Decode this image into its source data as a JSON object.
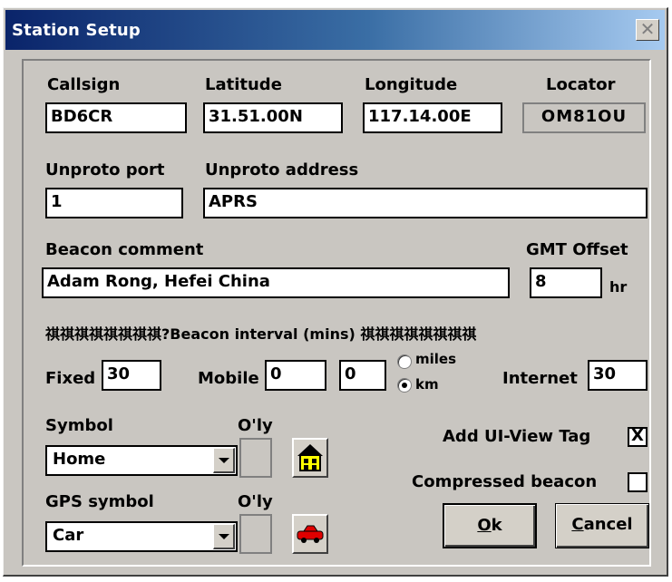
{
  "window": {
    "title": "Station Setup",
    "close_glyph": "✕"
  },
  "station": {
    "callsign_label": "Callsign",
    "callsign_value": "BD6CR",
    "latitude_label": "Latitude",
    "latitude_value": "31.51.00N",
    "longitude_label": "Longitude",
    "longitude_value": "117.14.00E",
    "locator_label": "Locator",
    "locator_value": "OM81OU"
  },
  "unproto": {
    "port_label": "Unproto port",
    "port_value": "1",
    "address_label": "Unproto address",
    "address_value": "APRS"
  },
  "beacon": {
    "comment_label": "Beacon comment",
    "comment_value": "Adam Rong, Hefei China",
    "gmt_label": "GMT Offset",
    "gmt_value": "8",
    "gmt_unit": "hr"
  },
  "interval": {
    "header_text": "祺祺祺祺祺祺祺祺?Beacon interval (mins) 祺祺祺祺祺祺祺祺",
    "fixed_label": "Fixed",
    "fixed_value": "30",
    "mobile_label": "Mobile",
    "mobile_value_1": "0",
    "mobile_value_2": "0",
    "unit_miles": "miles",
    "unit_km": "km",
    "selected_unit": "km",
    "internet_label": "Internet",
    "internet_value": "30"
  },
  "symbol": {
    "label": "Symbol",
    "oly_label": "O'ly",
    "selected": "Home",
    "icon": "house-icon"
  },
  "gps_symbol": {
    "label": "GPS symbol",
    "oly_label": "O'ly",
    "selected": "Car",
    "icon": "car-icon"
  },
  "options": {
    "add_tag_label": "Add UI-View Tag",
    "add_tag_checked": true,
    "check_mark": "X",
    "compressed_label": "Compressed beacon",
    "compressed_checked": false
  },
  "buttons": {
    "ok_mnemonic": "O",
    "ok_rest": "k",
    "cancel_mnemonic": "C",
    "cancel_rest": "ancel"
  },
  "colors": {
    "dialog_bg": "#c9c6c1",
    "title_start": "#0a246a",
    "title_end": "#a6caf0",
    "house_yellow": "#ffff00",
    "car_red": "#e00000"
  }
}
